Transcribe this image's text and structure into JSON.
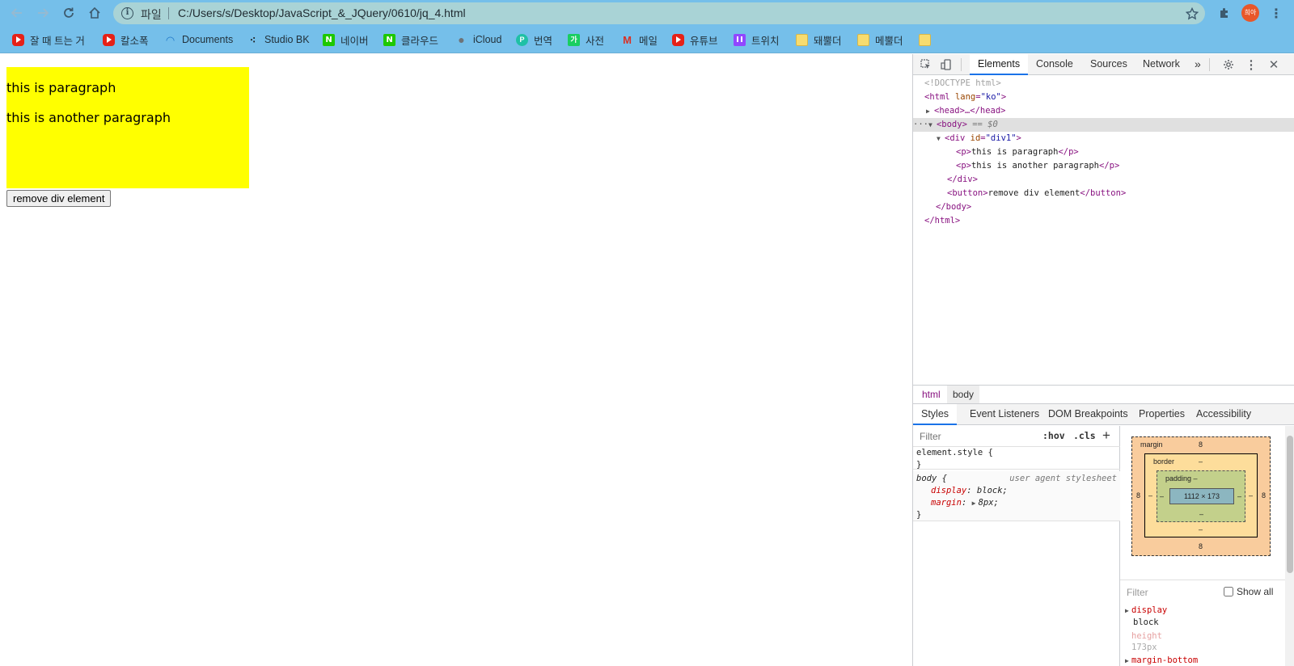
{
  "browser": {
    "address": {
      "scheme_label": "파일",
      "url": "C:/Users/s/Desktop/JavaScript_&_JQuery/0610/jq_4.html"
    },
    "profile_initials": "희아",
    "bookmarks": [
      {
        "label": "잘 때 트는 거",
        "icon": "youtube-icon"
      },
      {
        "label": "칼소폭",
        "icon": "youtube-icon"
      },
      {
        "label": "Documents",
        "icon": "wifi-icon"
      },
      {
        "label": "Studio BK",
        "icon": "studio-icon"
      },
      {
        "label": "네이버",
        "icon": "naver-icon"
      },
      {
        "label": "클라우드",
        "icon": "naver-icon"
      },
      {
        "label": "iCloud",
        "icon": "apple-icon"
      },
      {
        "label": "번역",
        "icon": "papago-icon"
      },
      {
        "label": "사전",
        "icon": "dictionary-icon"
      },
      {
        "label": "메일",
        "icon": "gmail-icon"
      },
      {
        "label": "유튜브",
        "icon": "youtube-icon"
      },
      {
        "label": "트위치",
        "icon": "twitch-icon"
      },
      {
        "label": "돼뿔더",
        "icon": "folder-icon"
      },
      {
        "label": "메뿔더",
        "icon": "folder-icon"
      },
      {
        "label": "",
        "icon": "folder-icon"
      }
    ]
  },
  "page": {
    "paragraphs": [
      "this is paragraph",
      "this is another paragraph"
    ],
    "button_label": "remove div element",
    "div_color": "#ffff00"
  },
  "devtools": {
    "tabs": [
      "Elements",
      "Console",
      "Sources",
      "Network"
    ],
    "more_tabs_glyph": "»",
    "dom": {
      "doctype": "<!DOCTYPE html>",
      "html_tag": "html",
      "html_attr_name": "lang",
      "html_attr_val": "\"ko\"",
      "head_collapsed": "<head>…</head>",
      "body_tag": "<body>",
      "body_ref": "== $0",
      "div_open_tag": "div",
      "div_attr_name": "id",
      "div_attr_val": "\"div1\"",
      "p1_text": "this is paragraph",
      "p2_text": "this is another paragraph",
      "div_close": "</div>",
      "button_text": "remove div element",
      "body_close": "</body>",
      "html_close": "</html>",
      "ellipsis": "···"
    },
    "breadcrumbs": [
      "html",
      "body"
    ],
    "subtabs": [
      "Styles",
      "Event Listeners",
      "DOM Breakpoints",
      "Properties",
      "Accessibility"
    ],
    "styles": {
      "filter_placeholder": "Filter",
      "hov": ":hov",
      "cls": ".cls",
      "plus": "+",
      "element_style_open": "element.style {",
      "close_brace": "}",
      "body_selector": "body {",
      "ua_label": "user agent stylesheet",
      "decl1_name": "display",
      "decl1_value": "block;",
      "decl2_name": "margin",
      "decl2_value": "8px;"
    },
    "box_model": {
      "margin_label": "margin",
      "margin_top": "8",
      "margin_bottom": "8",
      "margin_left": "8",
      "margin_right": "8",
      "border_label": "border",
      "border_top": "–",
      "border_bottom": "–",
      "border_left": "–",
      "border_right": "–",
      "padding_label": "padding –",
      "padding_bottom": "–",
      "padding_left": "–",
      "padding_right": "–",
      "content_size": "1112 × 173"
    },
    "computed": {
      "filter_placeholder": "Filter",
      "show_all": "Show all",
      "props": [
        {
          "name": "display",
          "value": "block"
        },
        {
          "name": "height",
          "value": "173px"
        },
        {
          "name": "margin-bottom",
          "value": ""
        }
      ]
    }
  }
}
